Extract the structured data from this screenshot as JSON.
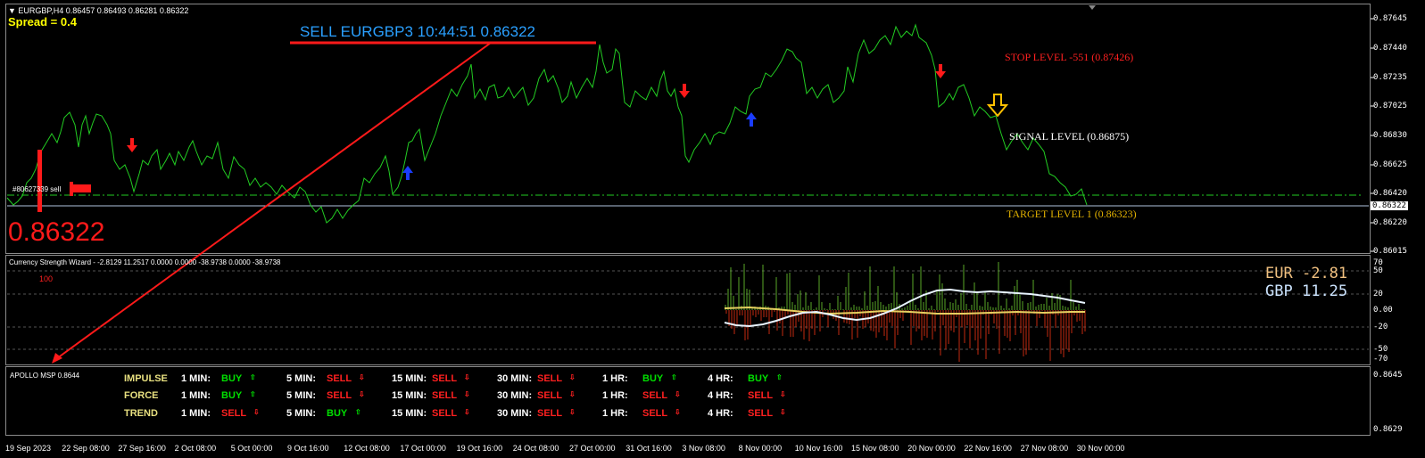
{
  "header": {
    "symbol_line": "▼ EURGBP,H4  0.86457 0.86493 0.86281 0.86322",
    "spread": "Spread = 0.4"
  },
  "trade": {
    "sell_label": "SELL EURGBP3 10:44:51 0.86322",
    "big_price": "0.86322",
    "order_tag": "#80627339 sell"
  },
  "levels": {
    "stop": "STOP LEVEL -551 (0.87426)",
    "signal": "SIGNAL LEVEL (0.86875)",
    "target": "TARGET LEVEL 1 (0.86323)"
  },
  "price_axis": [
    "0.87645",
    "0.87440",
    "0.87235",
    "0.87025",
    "0.86830",
    "0.86625",
    "0.86420",
    "0.86322",
    "0.86220",
    "0.86015"
  ],
  "current_price_box": "0.86322",
  "indicator": {
    "title": "Currency Strength Wizard - -2.8129 11.2517 0.0000 0.0000 -38.9738 0.0000 -38.9738",
    "level_100": "100",
    "eur_label": "EUR",
    "eur_value": "-2.81",
    "gbp_label": "GBP",
    "gbp_value": "11.25",
    "axis": [
      "70",
      "50",
      "20",
      "0.00",
      "-20",
      "-50",
      "-70"
    ]
  },
  "dashboard": {
    "title": "APOLLO MSP 0.8644",
    "axis_top": "0.8645",
    "axis_bottom": "0.8629",
    "rows": [
      {
        "name": "IMPULSE",
        "cells": [
          {
            "tf": "1 MIN:",
            "sig": "BUY",
            "c": "g"
          },
          {
            "tf": "5 MIN:",
            "sig": "SELL",
            "c": "r"
          },
          {
            "tf": "15 MIN:",
            "sig": "SELL",
            "c": "r"
          },
          {
            "tf": "30 MIN:",
            "sig": "SELL",
            "c": "r"
          },
          {
            "tf": "1 HR:",
            "sig": "BUY",
            "c": "g"
          },
          {
            "tf": "4 HR:",
            "sig": "BUY",
            "c": "g"
          }
        ]
      },
      {
        "name": "FORCE",
        "cells": [
          {
            "tf": "1 MIN:",
            "sig": "BUY",
            "c": "g"
          },
          {
            "tf": "5 MIN:",
            "sig": "SELL",
            "c": "r"
          },
          {
            "tf": "15 MIN:",
            "sig": "SELL",
            "c": "r"
          },
          {
            "tf": "30 MIN:",
            "sig": "SELL",
            "c": "r"
          },
          {
            "tf": "1 HR:",
            "sig": "SELL",
            "c": "r"
          },
          {
            "tf": "4 HR:",
            "sig": "SELL",
            "c": "r"
          }
        ]
      },
      {
        "name": "TREND",
        "cells": [
          {
            "tf": "1 MIN:",
            "sig": "SELL",
            "c": "r"
          },
          {
            "tf": "5 MIN:",
            "sig": "BUY",
            "c": "g"
          },
          {
            "tf": "15 MIN:",
            "sig": "SELL",
            "c": "r"
          },
          {
            "tf": "30 MIN:",
            "sig": "SELL",
            "c": "r"
          },
          {
            "tf": "1 HR:",
            "sig": "SELL",
            "c": "r"
          },
          {
            "tf": "4 HR:",
            "sig": "SELL",
            "c": "r"
          }
        ]
      }
    ]
  },
  "time_axis": [
    "19 Sep 2023",
    "22 Sep 08:00",
    "27 Sep 16:00",
    "2 Oct 08:00",
    "5 Oct 00:00",
    "9 Oct 16:00",
    "12 Oct 08:00",
    "17 Oct 00:00",
    "19 Oct 16:00",
    "24 Oct 08:00",
    "27 Oct 00:00",
    "31 Oct 16:00",
    "3 Nov 08:00",
    "8 Nov 00:00",
    "10 Nov 16:00",
    "15 Nov 08:00",
    "20 Nov 00:00",
    "22 Nov 16:00",
    "27 Nov 08:00",
    "30 Nov 00:00"
  ],
  "colors": {
    "price_line": "#22cc22",
    "sell_red": "#ff1a1a",
    "buy_blue": "#1a3cff",
    "signal_yellow": "#ffc000",
    "stop_text": "#ff2020",
    "target_text": "#e0b000",
    "sell_label": "#2aa0ff"
  }
}
